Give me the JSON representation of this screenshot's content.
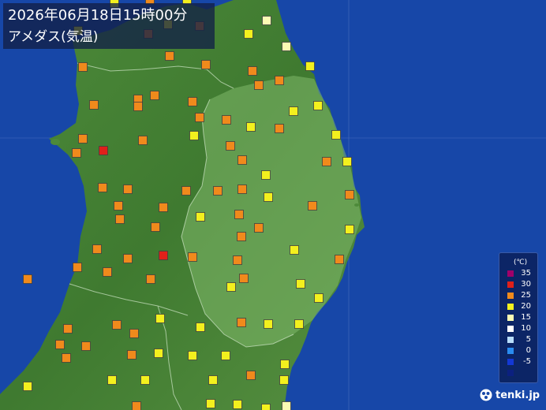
{
  "title": {
    "line1": "2026年06月18日15時00分",
    "line2": "アメダス(気温)"
  },
  "legend": {
    "unit": "(℃)",
    "items": [
      {
        "label": "35",
        "color": "#a0006a"
      },
      {
        "label": "30",
        "color": "#e0201a"
      },
      {
        "label": "25",
        "color": "#f08a1c"
      },
      {
        "label": "20",
        "color": "#f3f01e"
      },
      {
        "label": "15",
        "color": "#fbfbb4"
      },
      {
        "label": "10",
        "color": "#ffffff"
      },
      {
        "label": "5",
        "color": "#b8ddfb"
      },
      {
        "label": "0",
        "color": "#2a8cf0"
      },
      {
        "label": "-5",
        "color": "#1438d4"
      },
      {
        "label": "",
        "color": "#0c2080"
      }
    ]
  },
  "brand": {
    "name": "tenki.jp",
    "icon": "tenki-logo-icon"
  },
  "colors": {
    "sea": "#1747a8",
    "land": "#4f8a3c",
    "land_light": "#6aa851",
    "iwate_tint": "#8ac27a"
  }
}
